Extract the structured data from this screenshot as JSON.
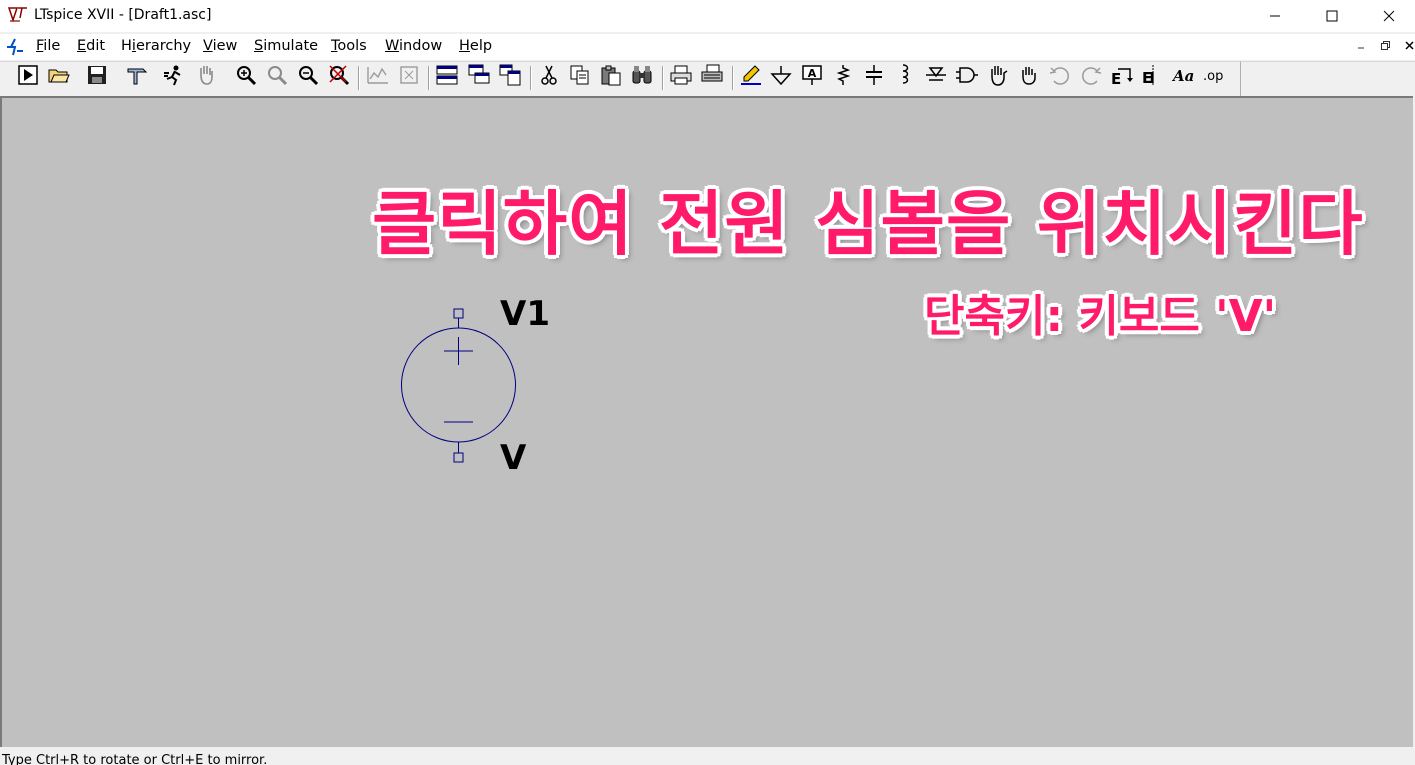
{
  "window": {
    "title": "LTspice XVII - [Draft1.asc]",
    "controls": [
      "minimize-icon",
      "maximize-icon",
      "close-icon"
    ]
  },
  "menubar": {
    "items": [
      {
        "label": "File",
        "u": "F",
        "rest": "ile"
      },
      {
        "label": "Edit",
        "u": "E",
        "rest": "dit"
      },
      {
        "label": "Hierarchy",
        "pre": "H",
        "u": "i",
        "rest": "erarchy"
      },
      {
        "label": "View",
        "u": "V",
        "rest": "iew"
      },
      {
        "label": "Simulate",
        "u": "S",
        "rest": "imulate"
      },
      {
        "label": "Tools",
        "u": "T",
        "rest": "ools"
      },
      {
        "label": "Window",
        "u": "W",
        "rest": "indow"
      },
      {
        "label": "Help",
        "u": "H",
        "rest": "elp"
      }
    ],
    "mdi_controls": [
      "mdi-minimize-icon",
      "mdi-restore-icon",
      "mdi-close-icon"
    ]
  },
  "toolbar": {
    "buttons": [
      "run-icon",
      "open-icon",
      "save-icon",
      "control-panel-icon",
      "halt-icon",
      "pan-icon",
      "zoom-in-icon",
      "zoom-full-icon",
      "zoom-out-icon",
      "zoom-cancel-icon",
      "autorange-icon",
      "fit-icon",
      "tile-horizontal-icon",
      "cascade-icon",
      "tile-vertical-icon",
      "cut-icon",
      "copy-icon",
      "paste-icon",
      "find-icon",
      "print-icon",
      "print-setup-icon",
      "wire-icon",
      "ground-icon",
      "label-net-icon",
      "resistor-icon",
      "capacitor-icon",
      "inductor-icon",
      "diode-icon",
      "component-icon",
      "move-icon",
      "drag-icon",
      "undo-icon",
      "redo-icon",
      "rotate-icon",
      "mirror-icon",
      "text-icon",
      "spice-directive-icon"
    ],
    "spice_directive_label": ".op",
    "text_label": "Aa"
  },
  "overlay": {
    "line1": "클릭하여 전원 심볼을 위치시킨다",
    "line2": "단축키: 키보드 'V'",
    "color": "#ff1a6a"
  },
  "schematic": {
    "component_name": "V1",
    "component_value": "V",
    "symbol_color": "#000080"
  },
  "status": {
    "text": "Type Ctrl+R to rotate or Ctrl+E to mirror."
  }
}
